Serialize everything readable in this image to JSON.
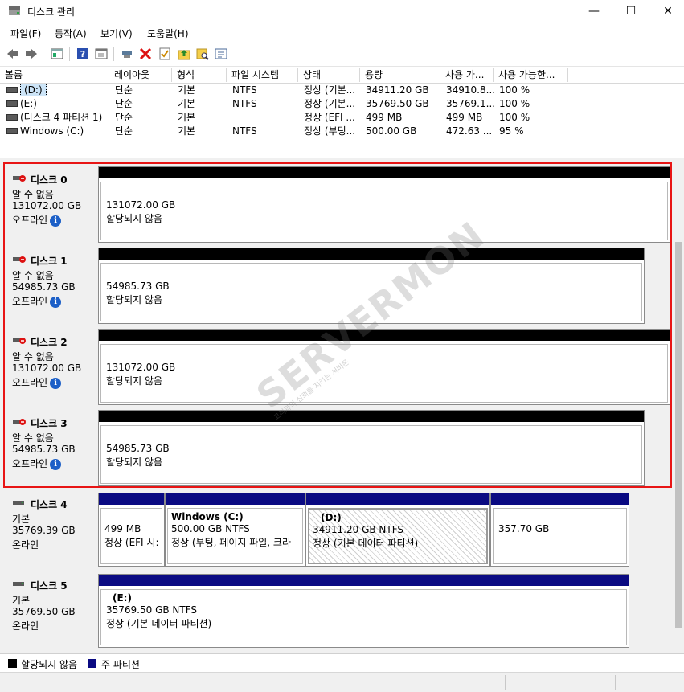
{
  "window": {
    "title": "디스크 관리",
    "minimize": "—",
    "maximize": "☐",
    "close": "✕"
  },
  "menu": [
    "파일(F)",
    "동작(A)",
    "보기(V)",
    "도움말(H)"
  ],
  "toolbar_icons": [
    "back-icon",
    "forward-icon",
    "disk-view-icon",
    "help-icon",
    "console-icon",
    "connect-icon",
    "delete-icon",
    "check-icon",
    "folder-up-icon",
    "search-folder-icon",
    "properties-icon"
  ],
  "volume_table": {
    "columns": [
      "볼륨",
      "레이아웃",
      "형식",
      "파일 시스템",
      "상태",
      "용량",
      "사용 가...",
      "사용 가능한..."
    ],
    "rows": [
      {
        "volume": "(D:)",
        "layout": "단순",
        "type": "기본",
        "fs": "NTFS",
        "status": "정상 (기본...",
        "capacity": "34911.20 GB",
        "free": "34910.8...",
        "pct": "100 %"
      },
      {
        "volume": "(E:)",
        "layout": "단순",
        "type": "기본",
        "fs": "NTFS",
        "status": "정상 (기본...",
        "capacity": "35769.50 GB",
        "free": "35769.1...",
        "pct": "100 %"
      },
      {
        "volume": "(디스크 4 파티션 1)",
        "layout": "단순",
        "type": "기본",
        "fs": "",
        "status": "정상 (EFI ...",
        "capacity": "499 MB",
        "free": "499 MB",
        "pct": "100 %"
      },
      {
        "volume": "Windows (C:)",
        "layout": "단순",
        "type": "기본",
        "fs": "NTFS",
        "status": "정상 (부팅...",
        "capacity": "500.00 GB",
        "free": "472.63 ...",
        "pct": "95 %"
      }
    ]
  },
  "disks": [
    {
      "name": "디스크 0",
      "line1": "알 수 없음",
      "line2": "131072.00 GB",
      "line3": "오프라인",
      "part_size": "131072.00 GB",
      "part_status": "할당되지 않음"
    },
    {
      "name": "디스크 1",
      "line1": "알 수 없음",
      "line2": "54985.73 GB",
      "line3": "오프라인",
      "part_size": "54985.73 GB",
      "part_status": "할당되지 않음"
    },
    {
      "name": "디스크 2",
      "line1": "알 수 없음",
      "line2": "131072.00 GB",
      "line3": "오프라인",
      "part_size": "131072.00 GB",
      "part_status": "할당되지 않음"
    },
    {
      "name": "디스크 3",
      "line1": "알 수 없음",
      "line2": "54985.73 GB",
      "line3": "오프라인",
      "part_size": "54985.73 GB",
      "part_status": "할당되지 않음"
    },
    {
      "name": "디스크 4",
      "line1": "기본",
      "line2": "35769.39 GB",
      "line3": "온라인",
      "partitions": [
        {
          "title": "",
          "size": "499 MB",
          "status": "정상 (EFI 시:"
        },
        {
          "title": "Windows  (C:)",
          "size": "500.00 GB NTFS",
          "status": "정상 (부팅, 페이지 파일, 크라"
        },
        {
          "title": "(D:)",
          "size": "34911.20 GB NTFS",
          "status": "정상 (기본 데이터 파티션)"
        },
        {
          "title": "",
          "size": "357.70 GB",
          "status": ""
        }
      ]
    },
    {
      "name": "디스크 5",
      "line1": "기본",
      "line2": "35769.50 GB",
      "line3": "온라인",
      "partitions": [
        {
          "title": "(E:)",
          "size": "35769.50 GB NTFS",
          "status": "정상 (기본 데이터 파티션)"
        }
      ]
    }
  ],
  "info_glyph": "i",
  "legend": [
    {
      "label": "할당되지 않음",
      "color": "#000000"
    },
    {
      "label": "주 파티션",
      "color": "#0a0a82"
    }
  ],
  "watermark": {
    "main": "SERVERMON",
    "sub": "고객과의 신뢰를 지키는 서버몬"
  },
  "colors": {
    "highlight": "#e81515",
    "primary_partition": "#0a0a82",
    "unallocated": "#000000"
  }
}
